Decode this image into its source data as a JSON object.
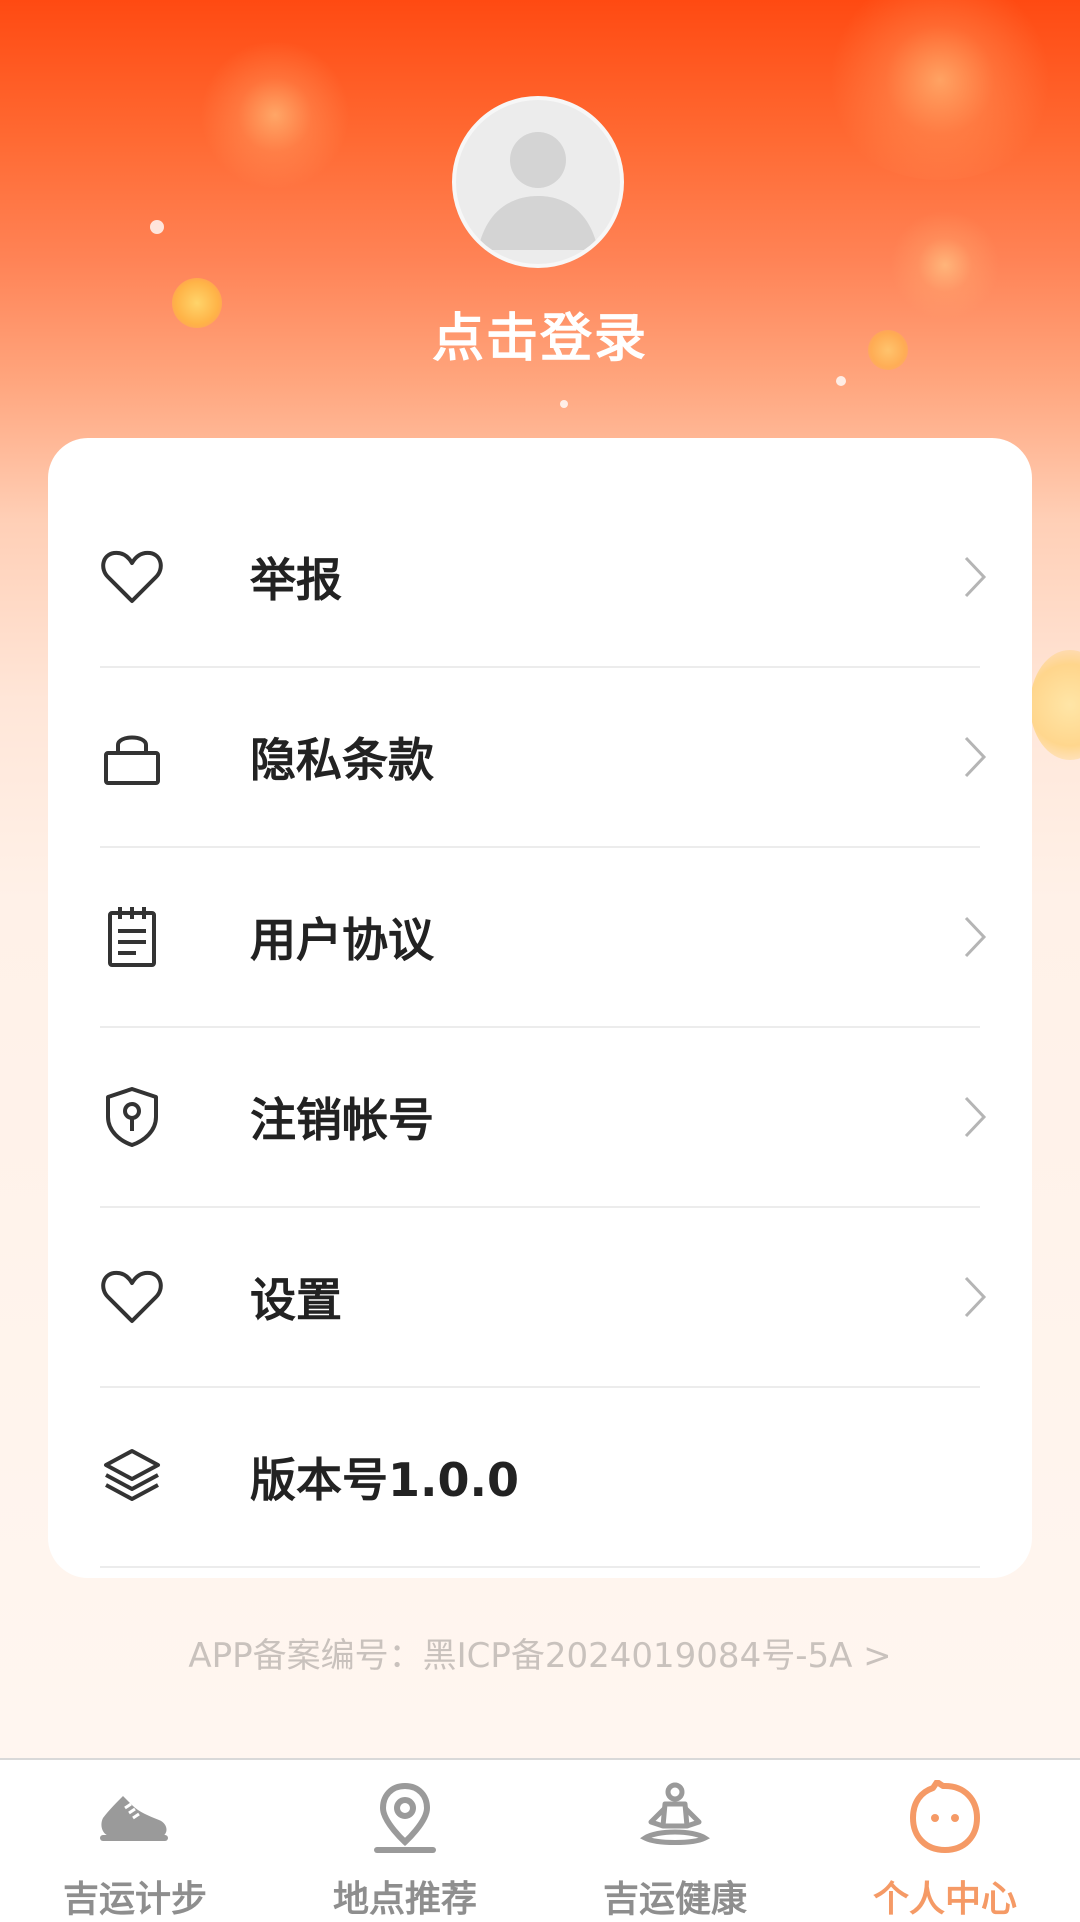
{
  "profile": {
    "login_text": "点击登录"
  },
  "menu": [
    {
      "label": "举报",
      "icon": "heart-icon"
    },
    {
      "label": "隐私条款",
      "icon": "lock-icon"
    },
    {
      "label": "用户协议",
      "icon": "notepad-icon"
    },
    {
      "label": "注销帐号",
      "icon": "shield-key-icon"
    },
    {
      "label": "设置",
      "icon": "heart-icon"
    },
    {
      "label": "版本号1.0.0",
      "icon": "layers-icon"
    }
  ],
  "footer": {
    "icp_text": "APP备案编号：黑ICP备2024019084号-5A >"
  },
  "tabbar": [
    {
      "label": "吉运计步",
      "icon": "sneaker-icon",
      "active": false
    },
    {
      "label": "地点推荐",
      "icon": "location-pin-icon",
      "active": false
    },
    {
      "label": "吉运健康",
      "icon": "meditation-icon",
      "active": false
    },
    {
      "label": "个人中心",
      "icon": "smiley-face-icon",
      "active": true
    }
  ],
  "colors": {
    "accent": "#f59a66",
    "header_top": "#ff4a12",
    "text": "#222222",
    "inactive": "#8e8e8e"
  }
}
